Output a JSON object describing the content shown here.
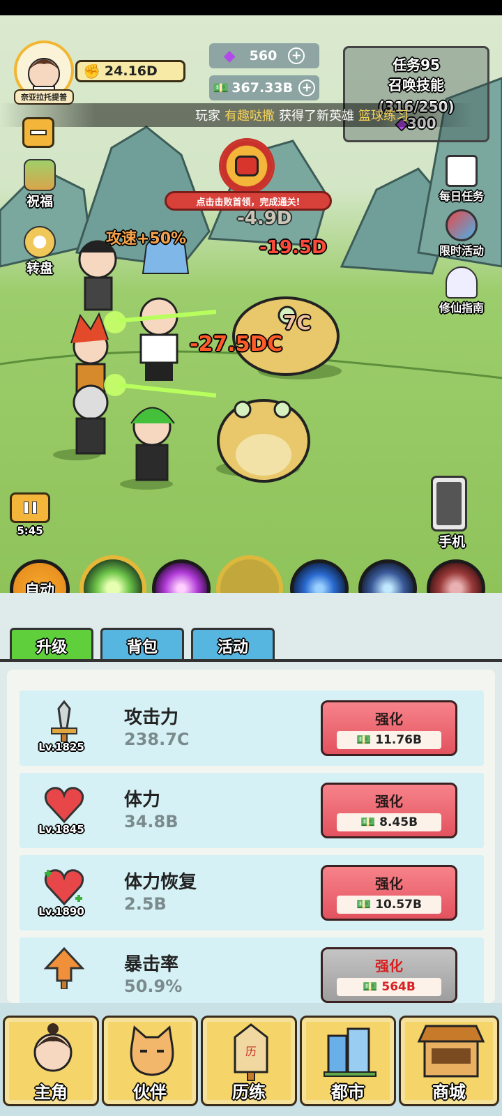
{
  "player": {
    "avatar_caption": "奈亚拉托提普",
    "power": "24.16D"
  },
  "currency": {
    "gems": "560",
    "cash": "367.33B"
  },
  "quest": {
    "title": "任务95",
    "name": "召唤技能",
    "progress": "(316/250)",
    "reward": "300"
  },
  "ticker": {
    "prefix": "玩家",
    "player_name": "有趣哒撒",
    "middle": "获得了新英雄",
    "hero": "篮球练习"
  },
  "left_icons": {
    "blessing": "祝福",
    "wheel": "转盘"
  },
  "right_icons": {
    "daily": "每日任务",
    "event": "限时活动",
    "guide": "修仙指南",
    "phone": "手机"
  },
  "boss_banner": "点击击败首领，完成通关!",
  "battle_text": {
    "atk_speed": "攻速+50%",
    "dmg1": "-4.9D",
    "dmg2": "-19.5D",
    "dmg3": "-27.5DC",
    "dmg4": "7C"
  },
  "timer": "5:45",
  "skills": {
    "auto": "自动"
  },
  "tabs": [
    "升级",
    "背包",
    "活动"
  ],
  "upgrade_button_label": "强化",
  "upgrades": [
    {
      "name": "攻击力",
      "value": "238.7C",
      "level": "Lv.1825",
      "cost": "11.76B",
      "affordable": true
    },
    {
      "name": "体力",
      "value": "34.8B",
      "level": "Lv.1845",
      "cost": "8.45B",
      "affordable": true
    },
    {
      "name": "体力恢复",
      "value": "2.5B",
      "level": "Lv.1890",
      "cost": "10.57B",
      "affordable": true
    },
    {
      "name": "暴击率",
      "value": "50.9%",
      "level": "",
      "cost": "564B",
      "affordable": false
    }
  ],
  "nav": [
    "主角",
    "伙伴",
    "历练",
    "都市",
    "商城"
  ],
  "colors": {
    "tab_active": "#5fcf3b",
    "tab_inactive": "#57b6e0",
    "button_red": "#e2525f",
    "panel": "#dfeaea"
  }
}
